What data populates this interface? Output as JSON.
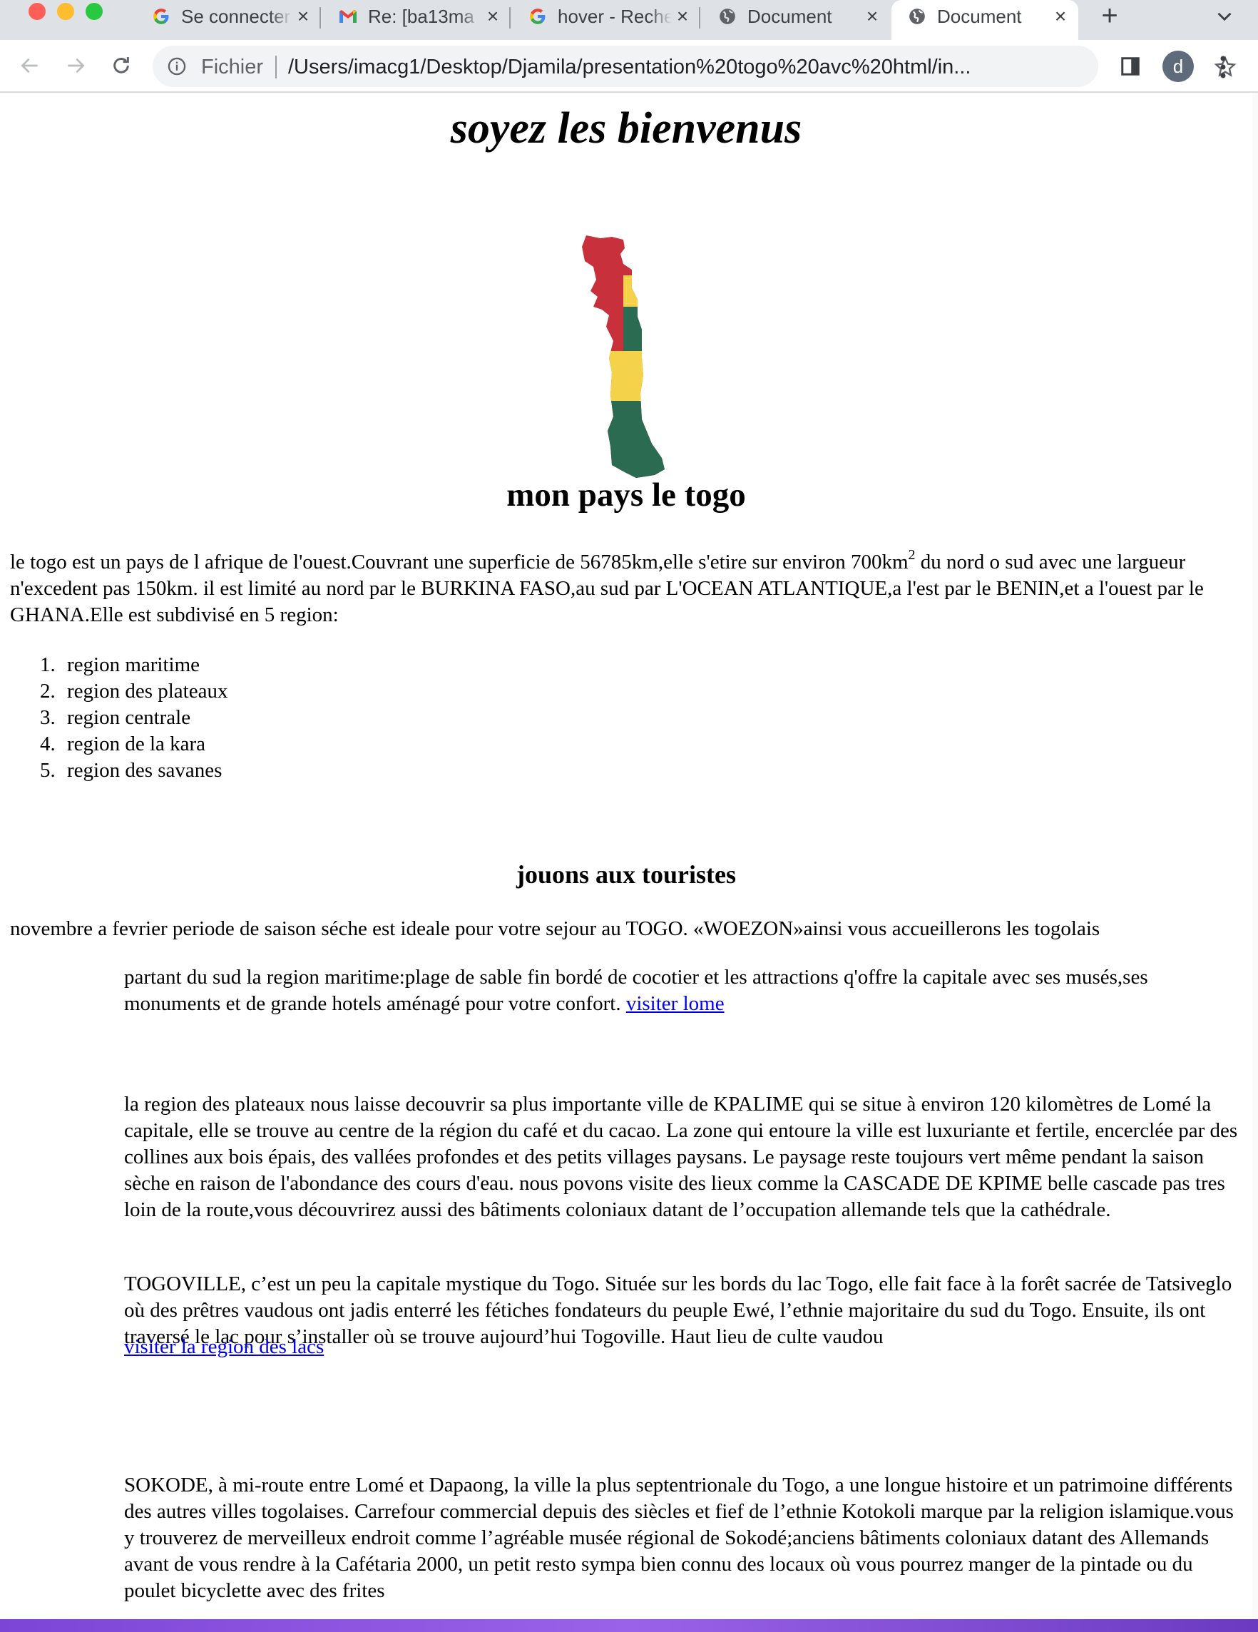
{
  "browser": {
    "tabs": [
      {
        "title": "Se connecter",
        "icon": "google-icon"
      },
      {
        "title": "Re: [ba13ma",
        "icon": "gmail-icon"
      },
      {
        "title": "hover - Recherche",
        "icon": "google-icon"
      },
      {
        "title": "Document",
        "icon": "globe-icon"
      },
      {
        "title": "Document",
        "icon": "globe-icon",
        "active": true
      }
    ],
    "address_bar": {
      "scheme_label": "Fichier",
      "url": "/Users/imacg1/Desktop/Djamila/presentation%20togo%20avc%20html/in..."
    },
    "profile_initial": "d",
    "colors": {
      "tabstrip": "#dee1e6",
      "omnibox": "#f1f3f4",
      "avatar": "#5f6b7a"
    }
  },
  "page": {
    "title": "soyez les bienvenus",
    "map_colors": {
      "red": "#c8313c",
      "yellow": "#f4d34a",
      "green": "#2b6b52"
    },
    "country_heading": "mon pays le togo",
    "intro": {
      "part1": "le togo est un pays de l afrique de l'ouest.Couvrant une superficie de 56785km,elle s'etire sur environ 700km",
      "sup": "2",
      "part2": " du nord o sud avec une largueur n'excedent pas 150km. il est limité au nord par le BURKINA FASO,au sud par L'OCEAN ATLANTIQUE,a l'est par le BENIN,et a l'ouest par le GHANA.Elle est subdivisé en 5 region:"
    },
    "regions": [
      {
        "num": "1.",
        "label": "region maritime"
      },
      {
        "num": "2.",
        "label": "region des plateaux"
      },
      {
        "num": "3.",
        "label": "region centrale"
      },
      {
        "num": "4.",
        "label": "region de la kara"
      },
      {
        "num": "5.",
        "label": "region des savanes"
      }
    ],
    "tourists_heading": "jouons aux touristes",
    "season_text": "novembre a fevrier periode de saison séche est ideale pour votre sejour au TOGO. «WOEZON»ainsi vous accueillerons les togolais",
    "maritime_text": "partant du sud la region maritime:plage de sable fin bordé de cocotier et les attractions q'offre la capitale avec ses musés,ses monuments et de grande hotels aménagé pour votre confort. ",
    "maritime_link": "visiter lome",
    "plateaux_text": "la region des plateaux nous laisse decouvrir sa plus importante ville de KPALIME qui se situe à environ 120 kilomètres de Lomé la capitale, elle se trouve au centre de la région du café et du cacao. La zone qui entoure la ville est luxuriante et fertile, encerclée par des collines aux bois épais, des vallées profondes et des petits villages paysans. Le paysage reste toujours vert même pendant la saison sèche en raison de l'abondance des cours d'eau. nous povons visite des lieux comme la CASCADE DE KPIME belle cascade pas tres loin de la route,vous découvrirez aussi des bâtiments coloniaux datant de l’occupation allemande tels que la cathédrale.",
    "togoville_text": "TOGOVILLE, c’est un peu la capitale mystique du Togo. Située sur les bords du lac Togo, elle fait face à la forêt sacrée de Tatsiveglo où des prêtres vaudous ont jadis enterré les fétiches fondateurs du peuple Ewé, l’ethnie majoritaire du sud du Togo. Ensuite, ils ont traversé le lac pour s’installer où se trouve aujourd’hui Togoville. Haut lieu de culte vaudou",
    "lacs_link": "visiter la region des lacs",
    "sokode_text": "SOKODE, à mi-route entre Lomé et Dapaong, la ville la plus septentrionale du Togo, a une longue histoire et un patrimoine différents des autres villes togolaises. Carrefour commercial depuis des siècles et fief de l’ethnie Kotokoli marque par la religion islamique.vous y trouverez de merveilleux endroit comme l’agréable musée régional de Sokodé;anciens bâtiments coloniaux datant des Allemands avant de vous rendre à la Cafétaria 2000, un petit resto sympa bien connu des locaux où vous pourrez manger de la pintade ou du poulet bicyclette avec des frites",
    "link_color": "#0000ee"
  }
}
